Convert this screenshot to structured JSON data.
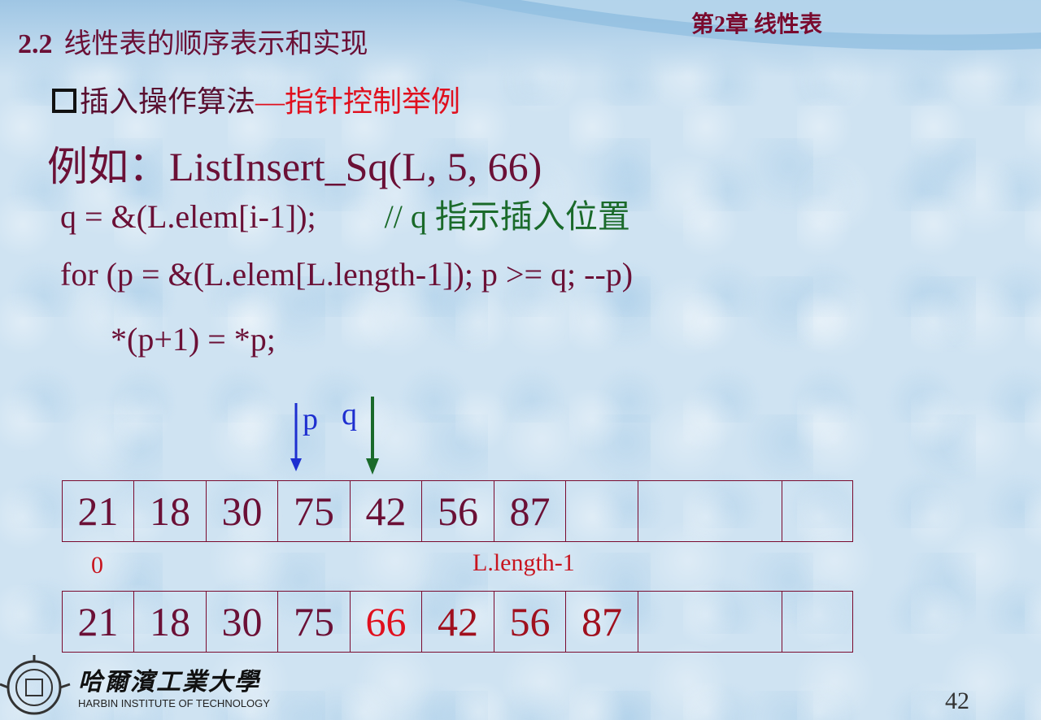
{
  "header": {
    "section_number": "2.2",
    "section_title": "线性表的顺序表示和实现",
    "chapter": "第2章  线性表"
  },
  "bullet": {
    "text_black": "插入操作算法",
    "text_red": "—指针控制举例"
  },
  "example": "例如：ListInsert_Sq(L, 5, 66)",
  "code": {
    "line1_code": "q = &(L.elem[i-1]);",
    "line1_comment": "// q 指示插入位置",
    "line2": "for (p = &(L.elem[L.length-1]); p >= q;  --p)",
    "line3": "*(p+1) = *p;"
  },
  "pointers": {
    "p_label": "p",
    "q_label": "q",
    "p_color": "#1e2fd0",
    "q_color": "#1a6a2a"
  },
  "array_before": [
    "21",
    "18",
    "30",
    "75",
    "42",
    "56",
    "87",
    "",
    "",
    ""
  ],
  "array_after": [
    "21",
    "18",
    "30",
    "75",
    "66",
    "42",
    "56",
    "87",
    "",
    ""
  ],
  "after_colors": [
    "#6b1036",
    "#6b1036",
    "#6b1036",
    "#6b1036",
    "#e0101e",
    "#a0101e",
    "#a0101e",
    "#a0101e",
    "#6b1036",
    "#6b1036"
  ],
  "index_labels": {
    "first": "0",
    "last": "L.length-1"
  },
  "logo": {
    "cn": "哈爾濱工業大學",
    "en": "HARBIN INSTITUTE OF TECHNOLOGY"
  },
  "page_number": "42",
  "colors": {
    "title": "#6b1036",
    "accent_red": "#e0101e",
    "comment_green": "#1a6a2a",
    "background": "#cfe3f2"
  }
}
